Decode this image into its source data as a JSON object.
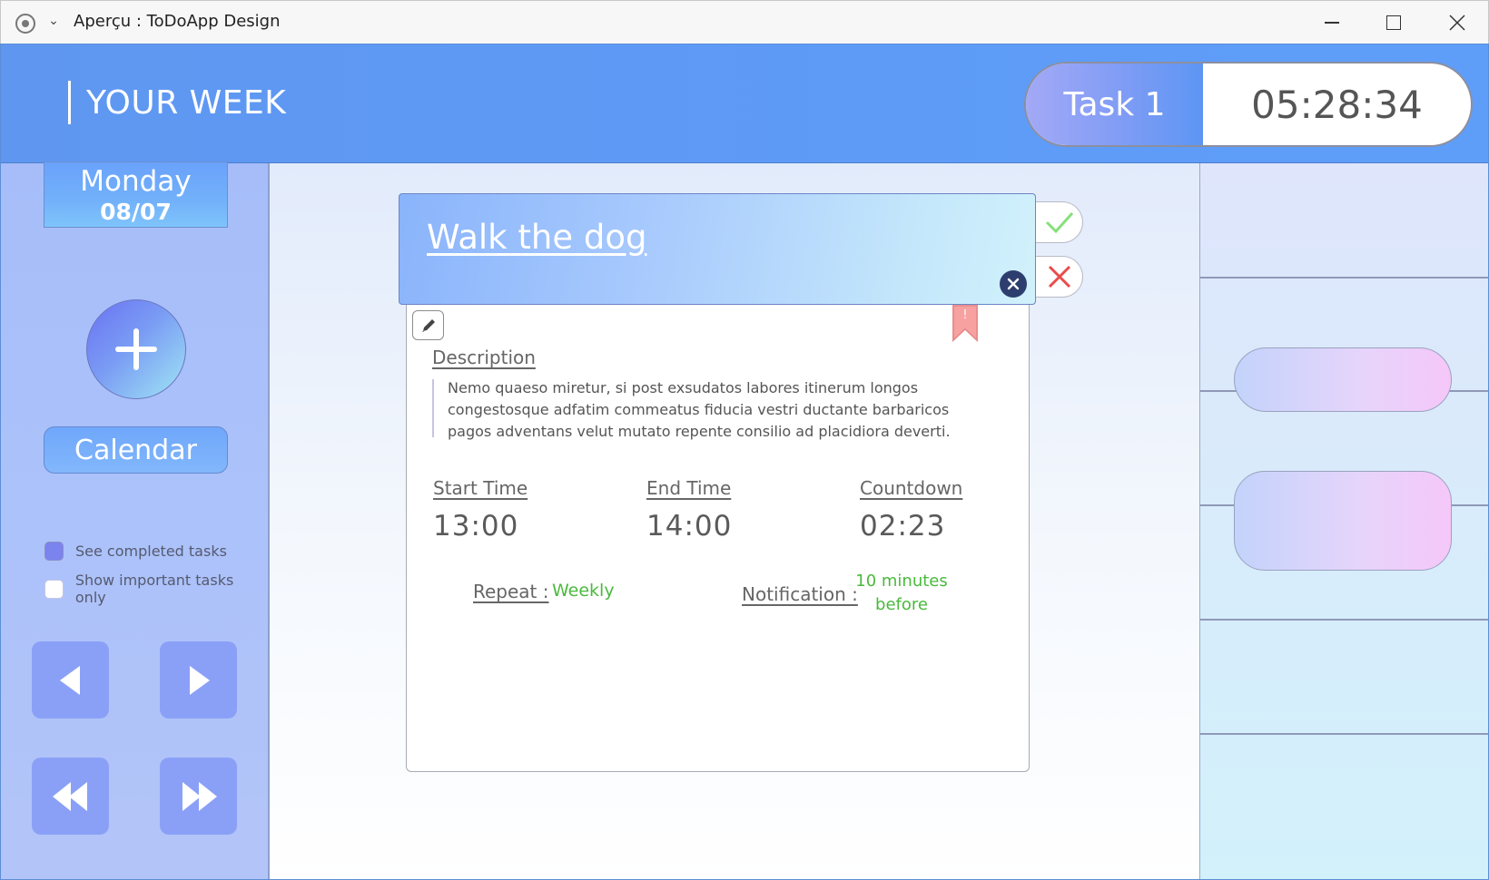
{
  "window": {
    "title": "Aperçu : ToDoApp Design",
    "chevron": "⌄"
  },
  "header": {
    "title": "YOUR WEEK",
    "current_task_label": "Task 1",
    "timer": "05:28:34"
  },
  "sidebar": {
    "day_name": "Monday",
    "date": "08/07",
    "calendar_label": "Calendar",
    "options": [
      {
        "label": "See completed tasks",
        "checked": true
      },
      {
        "label": "Show important tasks only",
        "checked": false
      }
    ]
  },
  "task": {
    "title": "Walk the dog",
    "description_label": "Description",
    "description": "Nemo quaeso miretur, si post exsudatos labores itinerum longos congestosque adfatim commeatus fiducia vestri ductante barbaricos pagos adventans velut mutato repente consilio ad placidiora deverti.",
    "start_label": "Start Time",
    "start_value": "13:00",
    "end_label": "End Time",
    "end_value": "14:00",
    "countdown_label": "Countdown",
    "countdown_value": "02:23",
    "repeat_label": "Repeat :",
    "repeat_value": "Weekly",
    "notification_label": "Notification :",
    "notification_value_line1": "10 minutes",
    "notification_value_line2": "before",
    "important_mark": "!"
  },
  "icons": {
    "confirm": "check-icon",
    "cancel": "cross-icon",
    "close": "close-icon",
    "edit": "pencil-icon",
    "bookmark": "bookmark-icon",
    "add": "plus-icon"
  },
  "colors": {
    "header_blue": "#5d9bf7",
    "accent_green": "#4aba3c",
    "cancel_red": "#ea4b4b",
    "confirm_green": "#86e07a",
    "bookmark_pink": "#f7a1a1",
    "nav_button": "#8aa0f7"
  }
}
